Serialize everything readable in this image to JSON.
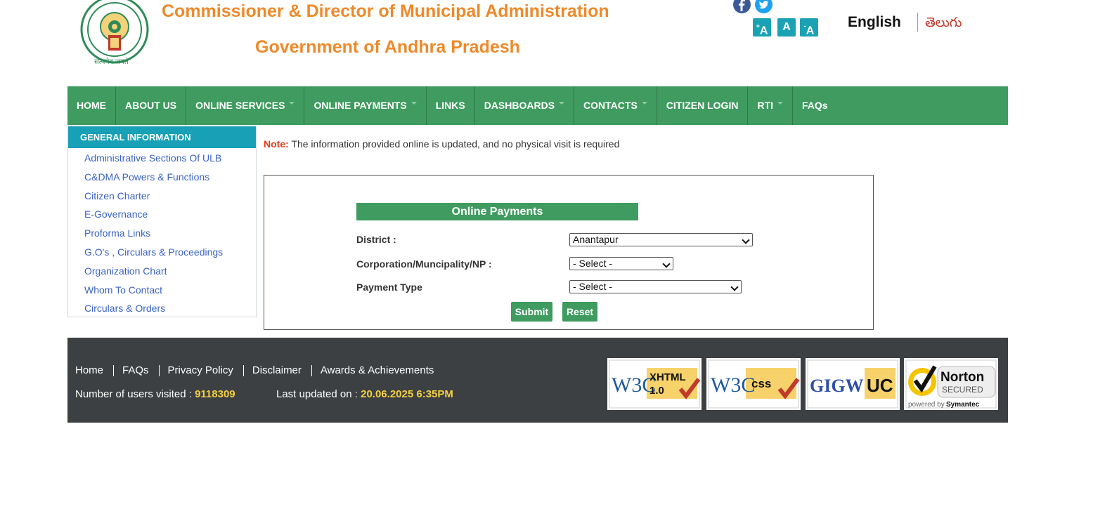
{
  "header": {
    "title_line1": "Commissioner & Director of Municipal Administration",
    "title_line2": "Government of Andhra Pradesh",
    "emblem_text": "सत्यमेव जयते",
    "font_controls": {
      "increase": "A",
      "normal": "A",
      "decrease": "A",
      "plus": "+",
      "minus": "-"
    },
    "lang_english": "English",
    "lang_telugu": "తెలుగు",
    "social": [
      "facebook-icon",
      "twitter-icon"
    ]
  },
  "nav": {
    "items": [
      {
        "label": "HOME"
      },
      {
        "label": "ABOUT US"
      },
      {
        "label": "ONLINE SERVICES"
      },
      {
        "label": "ONLINE PAYMENTS"
      },
      {
        "label": "LINKS"
      },
      {
        "label": "DASHBOARDS"
      },
      {
        "label": "CONTACTS"
      },
      {
        "label": "CITIZEN LOGIN"
      },
      {
        "label": "RTI"
      },
      {
        "label": "FAQs"
      }
    ]
  },
  "sidebar": {
    "heading": "GENERAL INFORMATION",
    "items": [
      "Administrative Sections Of ULB",
      "C&DMA Powers & Functions",
      "Citizen Charter",
      "E-Governance",
      "Proforma Links",
      "G.O's , Circulars & Proceedings",
      "Organization Chart",
      "Whom To Contact",
      "Circulars & Orders"
    ]
  },
  "note": {
    "label": "Note:",
    "text": " The information provided online is updated, and no physical visit is required"
  },
  "form": {
    "heading": "Online Payments",
    "district_label": "District :",
    "district_value": "Anantapur",
    "corporation_label": "Corporation/Muncipality/NP :",
    "corporation_value": "- Select -",
    "payment_label": "Payment Type",
    "payment_value": "- Select -",
    "submit": "Submit",
    "reset": "Reset"
  },
  "footer": {
    "links": [
      "Home",
      "FAQs",
      "Privacy Policy",
      "Disclaimer",
      "Awards & Achievements"
    ],
    "visits_label": "Number of users visited : ",
    "visits_value": "9118309",
    "updated_label": "Last updated on : ",
    "updated_value": "20.06.2025 6:35PM",
    "badges": {
      "xhtml_w3c": "W3C",
      "xhtml": "XHTML",
      "xhtml_ver": "1.0",
      "css_w3c": "W3C",
      "css": "css",
      "gigw": "GIGW",
      "uc": "UC",
      "norton": "Norton",
      "secured": "SECURED",
      "powered": "powered by",
      "symantec": "Symantec"
    }
  },
  "colors": {
    "nav_green": "#3f9b5f",
    "teal": "#17a0b6",
    "orange_title": "#ee8a2a",
    "footer_bg": "#3d4043",
    "highlight_yellow": "#f4d03f"
  }
}
